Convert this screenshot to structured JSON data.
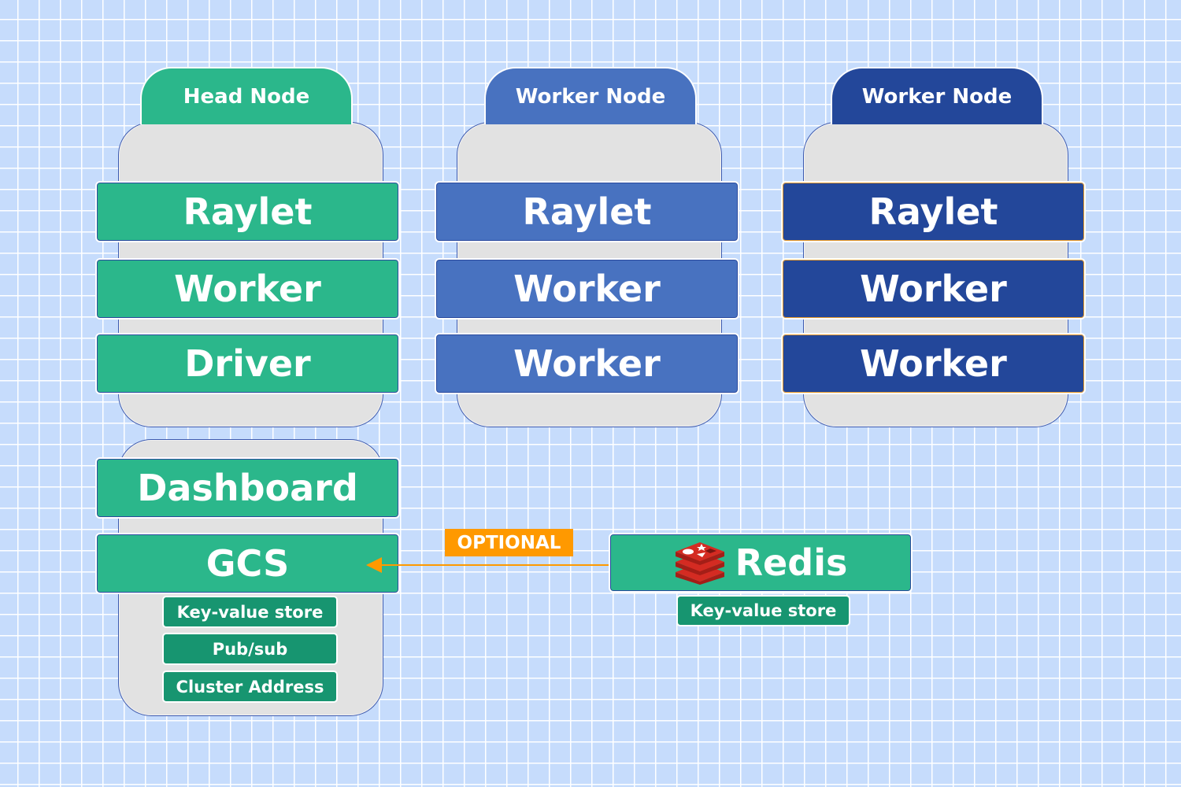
{
  "colors": {
    "green": "#2bb78b",
    "mid_blue": "#4872c0",
    "dark_blue": "#23479a",
    "sub_green": "#179570",
    "optional": "#ff9900",
    "redis_red": "#d42b22"
  },
  "head": {
    "title": "Head Node",
    "bars": [
      "Raylet",
      "Worker",
      "Driver"
    ],
    "dashboard": "Dashboard",
    "gcs": "GCS",
    "gcs_items": [
      "Key-value store",
      "Pub/sub",
      "Cluster Address"
    ]
  },
  "worker1": {
    "title": "Worker Node",
    "bars": [
      "Raylet",
      "Worker",
      "Worker"
    ]
  },
  "worker2": {
    "title": "Worker Node",
    "bars": [
      "Raylet",
      "Worker",
      "Worker"
    ]
  },
  "optional_label": "OPTIONAL",
  "redis": {
    "label": "Redis",
    "icon": "redis-logo",
    "item": "Key-value store"
  }
}
